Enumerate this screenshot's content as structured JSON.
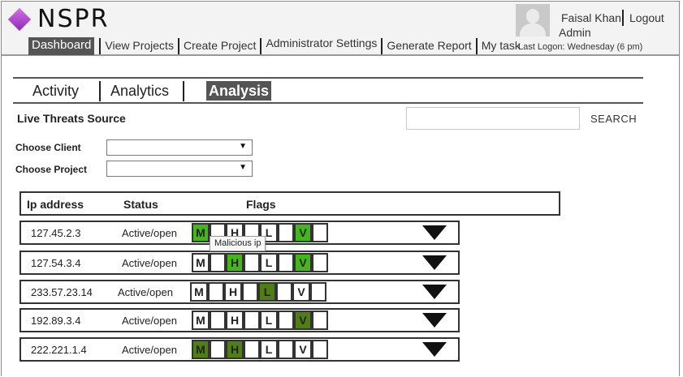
{
  "app": {
    "logo_text": "NSPR"
  },
  "nav": {
    "items": [
      {
        "label": "Dashboard",
        "active": true
      },
      {
        "label": "View Projects"
      },
      {
        "label": "Create Project"
      },
      {
        "label": "Administrator Settings"
      },
      {
        "label": "Generate Report"
      },
      {
        "label": "My task"
      }
    ]
  },
  "user": {
    "name": "Faisal Khan",
    "logout_label": "Logout",
    "role": "Admin",
    "last_logon": "Last Logon:  Wednesday (6 pm)",
    "avatar_icon": "user-silhouette-icon"
  },
  "tabs": [
    {
      "label": "Activity"
    },
    {
      "label": "Analytics"
    },
    {
      "label": "Analysis",
      "active": true
    }
  ],
  "section": {
    "title": "Live Threats Source"
  },
  "search": {
    "value": "",
    "placeholder": "",
    "button_label": "SEARCH"
  },
  "filters": {
    "client_label": "Choose Client",
    "client_value": "",
    "project_label": "Choose Project",
    "project_value": ""
  },
  "table": {
    "headers": {
      "ip": "Ip address",
      "status": "Status",
      "flags": "Flags"
    },
    "flag_labels": {
      "m": "M",
      "h": "H",
      "l": "L",
      "v": "V"
    },
    "rows": [
      {
        "ip": "127.45.2.3",
        "status": "Active/open",
        "flags": {
          "m": "bright",
          "h": "off",
          "l": "off",
          "v": "bright"
        }
      },
      {
        "ip": "127.54.3.4",
        "status": "Active/open",
        "flags": {
          "m": "off",
          "h": "bright",
          "l": "off",
          "v": "bright"
        }
      },
      {
        "ip": "233.57.23.14",
        "status": "Active/open",
        "flags": {
          "m": "off",
          "h": "off",
          "l": "dark",
          "v": "off"
        }
      },
      {
        "ip": "192.89.3.4",
        "status": "Active/open",
        "flags": {
          "m": "off",
          "h": "off",
          "l": "off",
          "v": "dark"
        }
      },
      {
        "ip": "222.221.1.4",
        "status": "Active/open",
        "flags": {
          "m": "dark",
          "h": "dark",
          "l": "off",
          "v": "off"
        }
      }
    ],
    "expand_icon": "triangle-down-icon"
  },
  "tooltip": {
    "text": "Malicious ip"
  },
  "colors": {
    "flag_bright": "#44b51a",
    "flag_dark": "#4f7f14",
    "active_bg": "#555555"
  }
}
